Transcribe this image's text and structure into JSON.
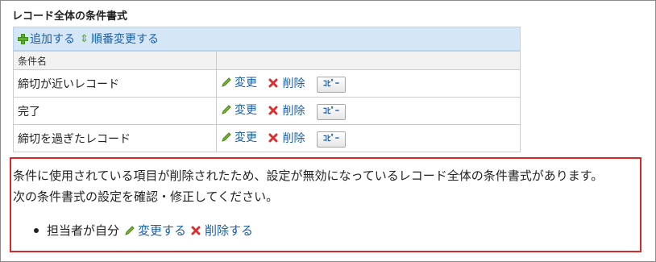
{
  "section": {
    "title": "レコード全体の条件書式"
  },
  "toolbar": {
    "add_label": "追加する",
    "reorder_label": "順番変更する"
  },
  "table": {
    "header_name": "条件名",
    "header_actions": "",
    "rows": [
      {
        "name": "締切が近いレコード",
        "edit": "変更",
        "delete": "削除",
        "copy": "ｺﾋﾟｰ"
      },
      {
        "name": "完了",
        "edit": "変更",
        "delete": "削除",
        "copy": "ｺﾋﾟｰ"
      },
      {
        "name": "締切を過ぎたレコード",
        "edit": "変更",
        "delete": "削除",
        "copy": "ｺﾋﾟｰ"
      }
    ]
  },
  "warning": {
    "line1": "条件に使用されている項目が削除されたため、設定が無効になっているレコード全体の条件書式があります。",
    "line2": "次の条件書式の設定を確認・修正してください。",
    "items": [
      {
        "name": "担当者が自分",
        "edit": "変更する",
        "delete": "削除する"
      }
    ]
  },
  "icons": {
    "add": "plus-icon",
    "reorder": "up-down-arrow-icon",
    "edit": "pencil-icon",
    "delete": "x-icon"
  },
  "colors": {
    "link": "#1b5fa8",
    "toolbar_bg": "#d5e7f7",
    "warning_border": "#d82828",
    "delete_red": "#d83030",
    "add_green": "#5fae2e"
  }
}
